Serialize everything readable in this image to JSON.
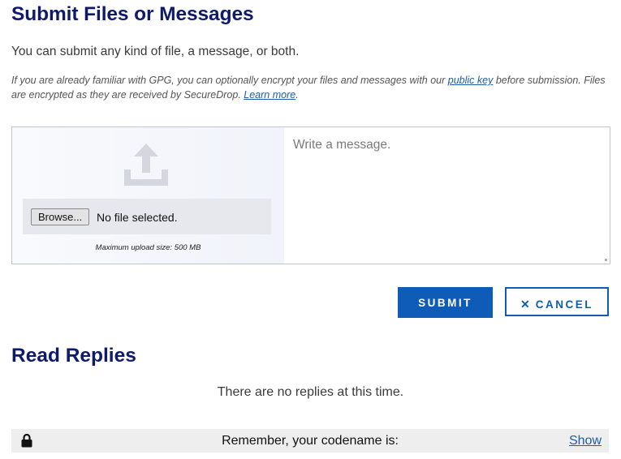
{
  "submit_section": {
    "title": "Submit Files or Messages",
    "intro": "You can submit any kind of file, a message, or both.",
    "gpg_note_prefix": "If you are already familiar with GPG, you can optionally encrypt your files and messages with our ",
    "gpg_link": "public key",
    "gpg_note_middle": " before submission. Files are encrypted as they are received by SecureDrop. ",
    "learn_more_link": "Learn more",
    "gpg_note_suffix": "."
  },
  "file_upload": {
    "icon": "upload-icon",
    "browse_label": "Browse...",
    "file_status": "No file selected.",
    "max_size": "Maximum upload size: 500 MB"
  },
  "message": {
    "placeholder": "Write a message.",
    "value": ""
  },
  "actions": {
    "submit_label": "SUBMIT",
    "cancel_icon": "✕",
    "cancel_label": "CANCEL"
  },
  "replies_section": {
    "title": "Read Replies",
    "empty_text": "There are no replies at this time."
  },
  "codename_bar": {
    "icon": "lock-icon",
    "text": "Remember, your codename is:",
    "show_link": "Show"
  },
  "colors": {
    "heading": "#0e1a6b",
    "accent": "#0e5cb8",
    "link": "#1c5da8"
  }
}
